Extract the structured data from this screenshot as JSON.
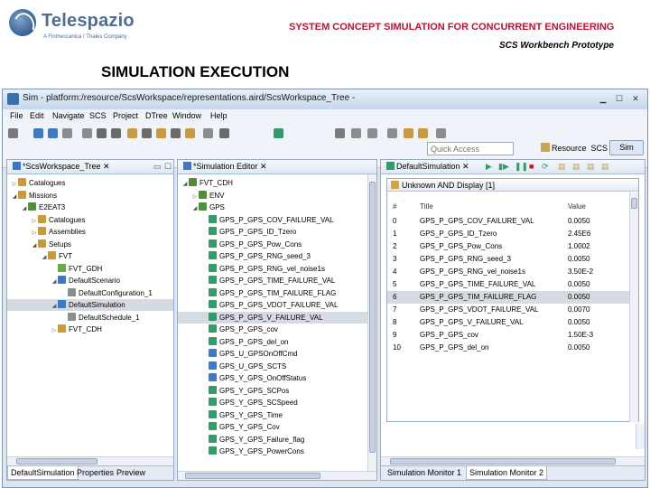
{
  "slide": {
    "logo_name": "Telespazio",
    "logo_sub": "A Finmeccanica / Thales Company",
    "title": "SYSTEM CONCEPT SIMULATION FOR CONCURRENT ENGINEERING",
    "subtitle": "SCS Workbench Prototype",
    "section": "SIMULATION EXECUTION"
  },
  "window": {
    "title": "Sim - platform:/resource/ScsWorkspace/representations.aird/ScsWorkspace_Tree -",
    "menu": [
      "File",
      "Edit",
      "Navigate",
      "SCS",
      "Project",
      "DTree",
      "Window",
      "Help"
    ],
    "quick_access_placeholder": "Quick Access",
    "perspective_resource": "Resource",
    "perspective_scs": "SCS",
    "perspective_sim": "Sim"
  },
  "tree_panel": {
    "tab": "*ScsWorkspace_Tree",
    "items": [
      {
        "label": "Catalogues",
        "depth": 0,
        "twisty": "▷",
        "color": "#c99a3c"
      },
      {
        "label": "Missions",
        "depth": 0,
        "twisty": "◢",
        "color": "#c99a3c"
      },
      {
        "label": "E2EAT3",
        "depth": 1,
        "twisty": "◢",
        "color": "#4f8f3c"
      },
      {
        "label": "Catalogues",
        "depth": 2,
        "twisty": "▷",
        "color": "#c99a3c"
      },
      {
        "label": "Assemblies",
        "depth": 2,
        "twisty": "▷",
        "color": "#c99a3c"
      },
      {
        "label": "Setups",
        "depth": 2,
        "twisty": "◢",
        "color": "#c99a3c"
      },
      {
        "label": "FVT",
        "depth": 3,
        "twisty": "◢",
        "color": "#c99a3c"
      },
      {
        "label": "FVT_GDH",
        "depth": 4,
        "twisty": "",
        "color": "#6aa84f"
      },
      {
        "label": "DefaultScenario",
        "depth": 4,
        "twisty": "◢",
        "color": "#3c7ac4"
      },
      {
        "label": "DefaultConfiguration_1",
        "depth": 5,
        "twisty": "",
        "color": "#8c8c8c"
      },
      {
        "label": "DefaultSimulation",
        "depth": 4,
        "twisty": "◢",
        "color": "#3c7ac4",
        "selected": true
      },
      {
        "label": "DefaultSchedule_1",
        "depth": 5,
        "twisty": "",
        "color": "#8c8c8c"
      },
      {
        "label": "FVT_CDH",
        "depth": 4,
        "twisty": "▷",
        "color": "#c99a3c"
      }
    ],
    "bottom_tabs": [
      "DefaultSimulation",
      "Properties",
      "Preview"
    ]
  },
  "editor_panel": {
    "tab": "*Simulation Editor",
    "items": [
      {
        "label": "FVT_CDH",
        "depth": 0,
        "twisty": "◢",
        "color": "#4f8f3c"
      },
      {
        "label": "ENV",
        "depth": 1,
        "twisty": "▷",
        "color": "#4f8f3c"
      },
      {
        "label": "GPS",
        "depth": 1,
        "twisty": "◢",
        "color": "#4f8f3c"
      },
      {
        "label": "GPS_P_GPS_COV_FAILURE_VAL",
        "depth": 2,
        "twisty": "",
        "color": "#2f9c6a"
      },
      {
        "label": "GPS_P_GPS_ID_Tzero",
        "depth": 2,
        "twisty": "",
        "color": "#2f9c6a"
      },
      {
        "label": "GPS_P_GPS_Pow_Cons",
        "depth": 2,
        "twisty": "",
        "color": "#2f9c6a"
      },
      {
        "label": "GPS_P_GPS_RNG_seed_3",
        "depth": 2,
        "twisty": "",
        "color": "#2f9c6a"
      },
      {
        "label": "GPS_P_GPS_RNG_vel_noise1s",
        "depth": 2,
        "twisty": "",
        "color": "#2f9c6a"
      },
      {
        "label": "GPS_P_GPS_TIME_FAILURE_VAL",
        "depth": 2,
        "twisty": "",
        "color": "#2f9c6a"
      },
      {
        "label": "GPS_P_GPS_TIM_FAILURE_FLAG",
        "depth": 2,
        "twisty": "",
        "color": "#2f9c6a"
      },
      {
        "label": "GPS_P_GPS_VDOT_FAILURE_VAL",
        "depth": 2,
        "twisty": "",
        "color": "#2f9c6a"
      },
      {
        "label": "GPS_P_GPS_V_FAILURE_VAL",
        "depth": 2,
        "twisty": "",
        "color": "#2f9c6a",
        "selected": true
      },
      {
        "label": "GPS_P_GPS_cov",
        "depth": 2,
        "twisty": "",
        "color": "#2f9c6a"
      },
      {
        "label": "GPS_P_GPS_del_on",
        "depth": 2,
        "twisty": "",
        "color": "#2f9c6a"
      },
      {
        "label": "GPS_U_GPSOnOffCmd",
        "depth": 2,
        "twisty": "",
        "color": "#3c7ac4"
      },
      {
        "label": "GPS_U_GPS_SCTS",
        "depth": 2,
        "twisty": "",
        "color": "#3c7ac4"
      },
      {
        "label": "GPS_Y_GPS_OnOffStatus",
        "depth": 2,
        "twisty": "",
        "color": "#3c7ac4"
      },
      {
        "label": "GPS_Y_GPS_SCPos",
        "depth": 2,
        "twisty": "",
        "color": "#2f9c6a"
      },
      {
        "label": "GPS_Y_GPS_SCSpeed",
        "depth": 2,
        "twisty": "",
        "color": "#2f9c6a"
      },
      {
        "label": "GPS_Y_GPS_Time",
        "depth": 2,
        "twisty": "",
        "color": "#2f9c6a"
      },
      {
        "label": "GPS_Y_GPS_Cov",
        "depth": 2,
        "twisty": "",
        "color": "#2f9c6a"
      },
      {
        "label": "GPS_Y_GPS_Failure_flag",
        "depth": 2,
        "twisty": "",
        "color": "#2f9c6a"
      },
      {
        "label": "GPS_Y_GPS_PowerCons",
        "depth": 2,
        "twisty": "",
        "color": "#2f9c6a"
      }
    ]
  },
  "monitor_panel": {
    "tab": "DefaultSimulation",
    "display_title": "Unknown AND Display [1]",
    "columns": [
      "#",
      "Title",
      "Value"
    ],
    "rows": [
      {
        "idx": "0",
        "title": "GPS_P_GPS_COV_FAILURE_VAL",
        "value": "0.0050"
      },
      {
        "idx": "1",
        "title": "GPS_P_GPS_ID_Tzero",
        "value": "2.45E6"
      },
      {
        "idx": "2",
        "title": "GPS_P_GPS_Pow_Cons",
        "value": "1.0002"
      },
      {
        "idx": "3",
        "title": "GPS_P_GPS_RNG_seed_3",
        "value": "0.0050"
      },
      {
        "idx": "4",
        "title": "GPS_P_GPS_RNG_vel_noise1s",
        "value": "3.50E-2"
      },
      {
        "idx": "5",
        "title": "GPS_P_GPS_TIME_FAILURE_VAL",
        "value": "0.0050"
      },
      {
        "idx": "6",
        "title": "GPS_P_GPS_TIM_FAILURE_FLAG",
        "value": "0.0050",
        "selected": true
      },
      {
        "idx": "7",
        "title": "GPS_P_GPS_VDOT_FAILURE_VAL",
        "value": "0.0070"
      },
      {
        "idx": "8",
        "title": "GPS_P_GPS_V_FAILURE_VAL",
        "value": "0.0050"
      },
      {
        "idx": "9",
        "title": "GPS_P_GPS_cov",
        "value": "1.50E-3"
      },
      {
        "idx": "10",
        "title": "GPS_P_GPS_del_on",
        "value": "0.0050"
      }
    ],
    "bottom_tabs": [
      "Simulation Monitor 1",
      "Simulation Monitor 2"
    ]
  },
  "colors": {
    "title_red": "#c4122f",
    "window_frame": "#dce6f2",
    "selection": "#d6dbe2"
  }
}
